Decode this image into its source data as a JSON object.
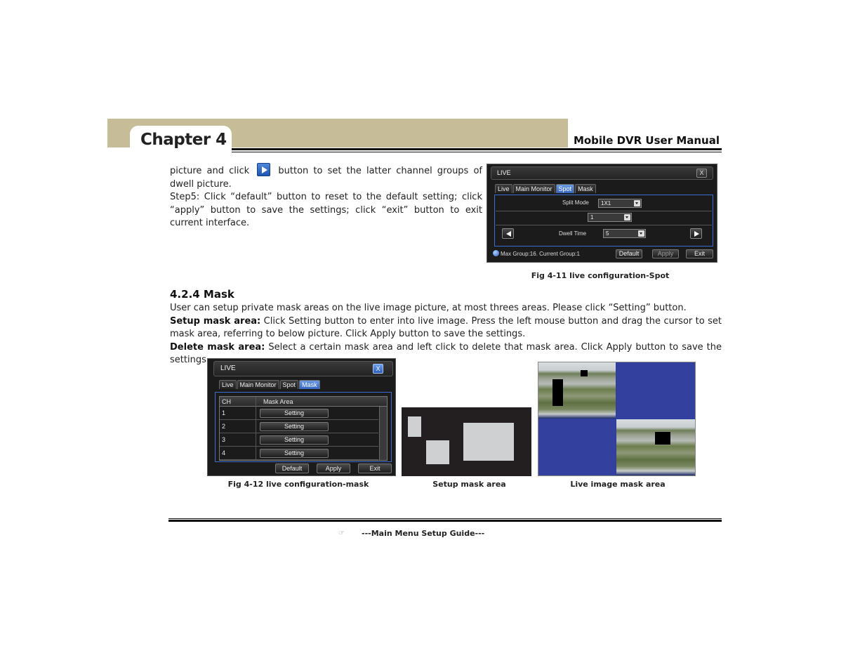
{
  "header": {
    "chapter_title": "Chapter 4",
    "manual_title": "Mobile DVR User Manual"
  },
  "intro": {
    "line1_before_icon": "picture and click",
    "line1_after_icon": "button to set the latter channel groups of dwell picture.",
    "icon": "next-arrow-icon",
    "step5": "Step5: Click “default” button to reset to the default setting; click “apply” button to save the settings; click “exit” button to exit current interface."
  },
  "spot_dialog": {
    "title": "LIVE",
    "close_label": "X",
    "tabs": [
      {
        "label": "Live",
        "active": false
      },
      {
        "label": "Main Monitor",
        "active": false
      },
      {
        "label": "Spot",
        "active": true
      },
      {
        "label": "Mask",
        "active": false
      }
    ],
    "split_mode_label": "Split Mode",
    "split_mode_value": "1X1",
    "channel_value": "1",
    "dwell_time_label": "Dwell Time",
    "dwell_time_value": "5",
    "status_text": "Max  Group:16.  Current  Group:1",
    "buttons": {
      "default": "Default",
      "apply": "Apply",
      "exit": "Exit"
    }
  },
  "fig_4_11_caption": "Fig 4-11 live configuration-Spot",
  "section": {
    "heading": "4.2.4  Mask",
    "intro": "User can setup private mask areas on the live image picture, at most threes areas. Please click “Setting” button.",
    "setup_label": "Setup mask area:",
    "setup_text": " Click Setting button to enter into live image. Press the left mouse button and drag the cursor to set mask area, referring to below picture. Click Apply button to save the settings.",
    "delete_label": "Delete mask area:",
    "delete_text": " Select a certain mask area and left click to delete that mask area. Click Apply button to save the settings."
  },
  "mask_dialog": {
    "title": "LIVE",
    "close_label": "X",
    "tabs": [
      {
        "label": "Live",
        "active": false
      },
      {
        "label": "Main Monitor",
        "active": false
      },
      {
        "label": "Spot",
        "active": false
      },
      {
        "label": "Mask",
        "active": true
      }
    ],
    "columns": [
      "CH",
      "Mask Area"
    ],
    "rows": [
      {
        "ch": "1",
        "action": "Setting"
      },
      {
        "ch": "2",
        "action": "Setting"
      },
      {
        "ch": "3",
        "action": "Setting"
      },
      {
        "ch": "4",
        "action": "Setting"
      }
    ],
    "buttons": {
      "default": "Default",
      "apply": "Apply",
      "exit": "Exit"
    }
  },
  "captions": {
    "fig_4_12": "Fig 4-12 live configuration-mask",
    "setup_mask": "Setup mask area",
    "live_mask": "Live image mask area"
  },
  "colors": {
    "header_band": "#c7bc98",
    "active_tab": "#3465c0",
    "no_video_blue": "#33409e"
  },
  "footer": {
    "icon": "pointing-hand-icon",
    "text": "---Main Menu Setup Guide---"
  }
}
